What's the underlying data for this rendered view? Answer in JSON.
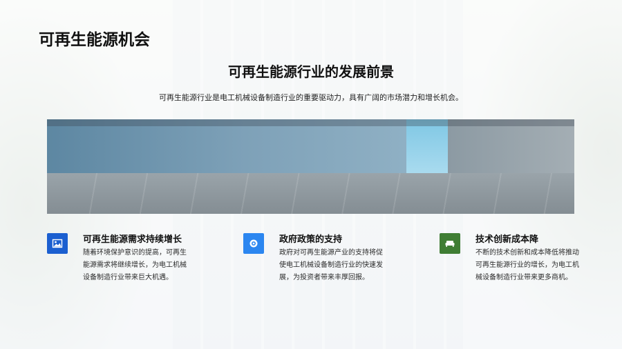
{
  "slide": {
    "title": "可再生能源机会",
    "headline": "可再生能源行业的发展前景",
    "subline": "可再生能源行业是电工机械设备制造行业的重要驱动力，具有广阔的市场潜力和增长机会。"
  },
  "cards": [
    {
      "icon": "image-icon",
      "title": "可再生能源需求持续增长",
      "body": "随着环境保护意识的提高，可再生能源需求将继续增长，为电工机械设备制造行业带来巨大机遇。",
      "color": "#1b5fd0"
    },
    {
      "icon": "target-icon",
      "title": "政府政策的支持",
      "body": "政府对可再生能源产业的支持将促使电工机械设备制造行业的快速发展，为投资者带来丰厚回报。",
      "color": "#2b86f0"
    },
    {
      "icon": "sofa-icon",
      "title": "技术创新成本降",
      "body": "不断的技术创新和成本降低将推动可再生能源行业的增长，为电工机械设备制造行业带来更多商机。",
      "color": "#3f7d34"
    }
  ]
}
